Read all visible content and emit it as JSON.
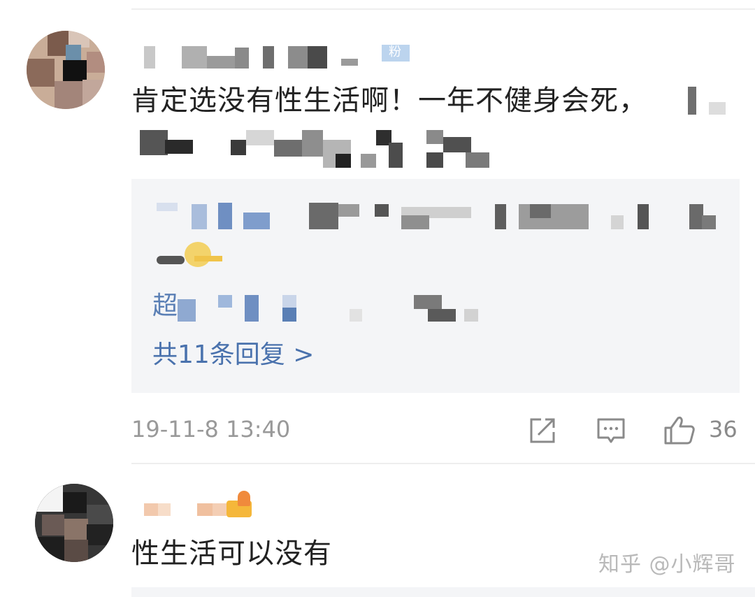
{
  "comments": [
    {
      "text_line1": "肯定选没有性生活啊！一年不健身会死，",
      "badge": "粉",
      "reply_box": {
        "more_replies": "共11条回复 >",
        "reply_prefix": "超"
      },
      "timestamp": "19-11-8 13:40",
      "likes": "36",
      "actions": {
        "share_icon": "share-icon",
        "comment_icon": "comment-icon",
        "like_icon": "thumbs-up-icon"
      }
    },
    {
      "text_line1": "性生活可以没有"
    }
  ],
  "watermark": "知乎 @小辉哥",
  "colors": {
    "link_blue": "#4a72ad",
    "meta_gray": "#999999",
    "reply_bg": "#f4f5f7"
  }
}
